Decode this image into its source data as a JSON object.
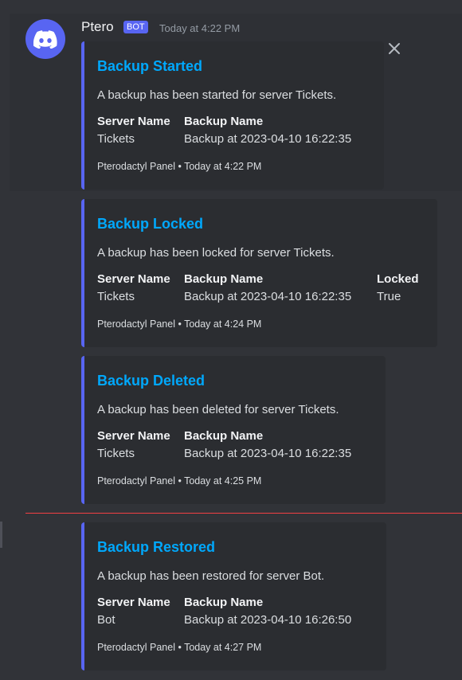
{
  "message": {
    "author": "Ptero",
    "badge": "BOT",
    "timestamp": "Today at 4:22 PM"
  },
  "embeds": [
    {
      "title": "Backup Started",
      "description": "A backup has been started for server Tickets.",
      "fields": [
        {
          "name": "Server Name",
          "value": "Tickets"
        },
        {
          "name": "Backup Name",
          "value": "Backup at 2023-04-10 16:22:35"
        }
      ],
      "footer": "Pterodactyl Panel • Today at 4:22 PM"
    },
    {
      "title": "Backup Locked",
      "description": "A backup has been locked for server Tickets.",
      "fields": [
        {
          "name": "Server Name",
          "value": "Tickets"
        },
        {
          "name": "Backup Name",
          "value": "Backup at 2023-04-10 16:22:35"
        },
        {
          "name": "Locked",
          "value": "True"
        }
      ],
      "footer": "Pterodactyl Panel • Today at 4:24 PM"
    },
    {
      "title": "Backup Deleted",
      "description": "A backup has been deleted for server Tickets.",
      "fields": [
        {
          "name": "Server Name",
          "value": "Tickets"
        },
        {
          "name": "Backup Name",
          "value": "Backup at 2023-04-10 16:22:35"
        }
      ],
      "footer": "Pterodactyl Panel • Today at 4:25 PM"
    },
    {
      "title": "Backup Restored",
      "description": "A backup has been restored for server Bot.",
      "fields": [
        {
          "name": "Server Name",
          "value": "Bot"
        },
        {
          "name": "Backup Name",
          "value": "Backup at 2023-04-10 16:26:50"
        }
      ],
      "footer": "Pterodactyl Panel • Today at 4:27 PM"
    }
  ],
  "colors": {
    "embed_accent": "#5865f2",
    "title_link": "#00a8fc",
    "new_messages_divider": "#f23f43"
  }
}
